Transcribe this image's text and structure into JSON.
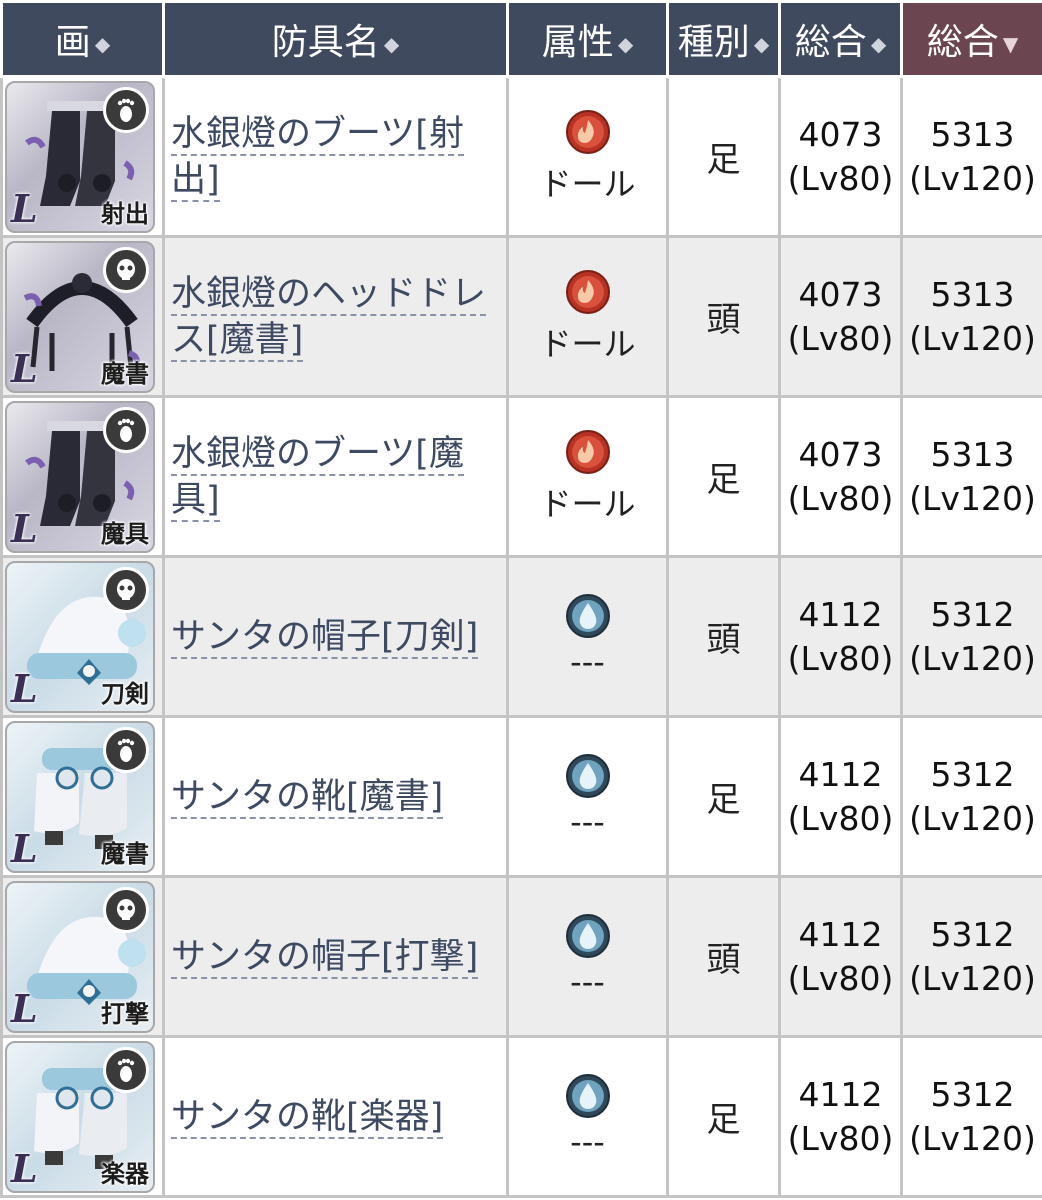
{
  "headers": [
    {
      "label": "画",
      "arrows": "◆"
    },
    {
      "label": "防具名",
      "arrows": "◆"
    },
    {
      "label": "属性",
      "arrows": "◆"
    },
    {
      "label": "種別",
      "arrows": "◆"
    },
    {
      "label": "総合",
      "arrows": "◆"
    },
    {
      "label": "総合",
      "arrows": "▼"
    }
  ],
  "colors": {
    "header_bg": "#3f4a5e",
    "header_sorted_bg": "#6b4650",
    "link": "#3d4a62",
    "fire_attr": "#c0392b",
    "water_attr": "#5d8fa8"
  },
  "rows": [
    {
      "icon": "boots-icon",
      "slot_icon": "foot-icon",
      "rarity": "L",
      "weapon": "射出",
      "name": "水銀燈のブーツ[射出]",
      "attr_icon": "fire-attr-icon",
      "attr": "ドール",
      "type": "足",
      "total1": "4073",
      "lv1": "(Lv80)",
      "total2": "5313",
      "lv2": "(Lv120)"
    },
    {
      "icon": "headdress-icon",
      "slot_icon": "head-icon",
      "rarity": "L",
      "weapon": "魔書",
      "name": "水銀燈のヘッドドレス[魔書]",
      "attr_icon": "fire-attr-icon",
      "attr": "ドール",
      "type": "頭",
      "total1": "4073",
      "lv1": "(Lv80)",
      "total2": "5313",
      "lv2": "(Lv120)"
    },
    {
      "icon": "boots-icon",
      "slot_icon": "foot-icon",
      "rarity": "L",
      "weapon": "魔具",
      "name": "水銀燈のブーツ[魔具]",
      "attr_icon": "fire-attr-icon",
      "attr": "ドール",
      "type": "足",
      "total1": "4073",
      "lv1": "(Lv80)",
      "total2": "5313",
      "lv2": "(Lv120)"
    },
    {
      "icon": "santa-hat-icon",
      "slot_icon": "head-icon",
      "rarity": "L",
      "weapon": "刀剣",
      "name": "サンタの帽子[刀剣]",
      "attr_icon": "water-attr-icon",
      "attr": "---",
      "type": "頭",
      "total1": "4112",
      "lv1": "(Lv80)",
      "total2": "5312",
      "lv2": "(Lv120)"
    },
    {
      "icon": "santa-boots-icon",
      "slot_icon": "foot-icon",
      "rarity": "L",
      "weapon": "魔書",
      "name": "サンタの靴[魔書]",
      "attr_icon": "water-attr-icon",
      "attr": "---",
      "type": "足",
      "total1": "4112",
      "lv1": "(Lv80)",
      "total2": "5312",
      "lv2": "(Lv120)"
    },
    {
      "icon": "santa-hat-icon",
      "slot_icon": "head-icon",
      "rarity": "L",
      "weapon": "打撃",
      "name": "サンタの帽子[打撃]",
      "attr_icon": "water-attr-icon",
      "attr": "---",
      "type": "頭",
      "total1": "4112",
      "lv1": "(Lv80)",
      "total2": "5312",
      "lv2": "(Lv120)"
    },
    {
      "icon": "santa-boots-icon",
      "slot_icon": "foot-icon",
      "rarity": "L",
      "weapon": "楽器",
      "name": "サンタの靴[楽器]",
      "attr_icon": "water-attr-icon",
      "attr": "---",
      "type": "足",
      "total1": "4112",
      "lv1": "(Lv80)",
      "total2": "5312",
      "lv2": "(Lv120)"
    }
  ]
}
